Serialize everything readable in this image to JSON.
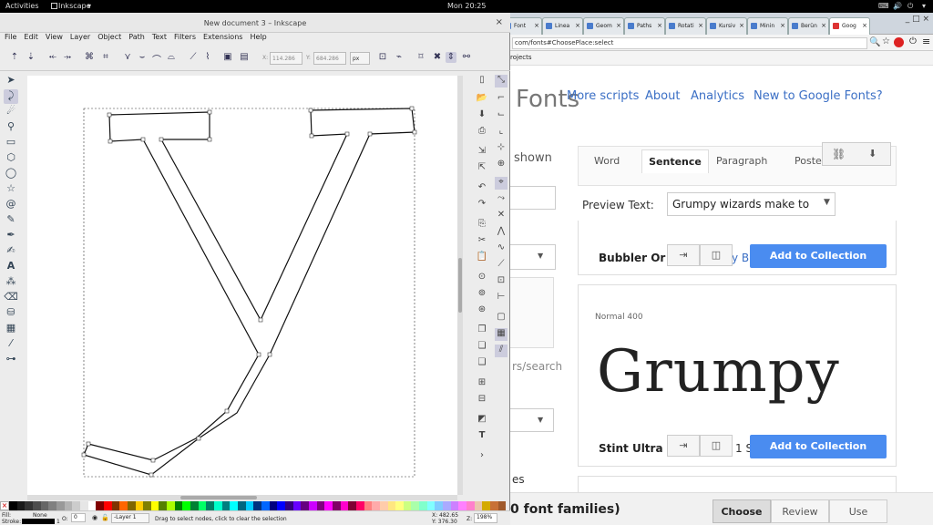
{
  "topbar": {
    "activities": "Activities",
    "app": "Inkscape",
    "clock": "Mon 20:25"
  },
  "inkscape": {
    "title": "New document 3 – Inkscape",
    "menu": [
      "File",
      "Edit",
      "View",
      "Layer",
      "Object",
      "Path",
      "Text",
      "Filters",
      "Extensions",
      "Help"
    ],
    "x_label": "X:",
    "x_value": "114.286",
    "y_label": "Y:",
    "y_value": "684.286",
    "unit": "px",
    "status_message": "Drag to select nodes, click to clear the selection",
    "fill_label": "Fill:",
    "fill_value": "None",
    "stroke_label": "Stroke:",
    "stroke_width": "1",
    "opacity_label": "O:",
    "opacity_value": "0",
    "layer": "-Layer 1",
    "cursor_x": "X: 482.65",
    "cursor_y": "Y: 376.30",
    "zoom_label": "Z:",
    "zoom": "198%",
    "palette": [
      "#000000",
      "#1a1a1a",
      "#333333",
      "#4d4d4d",
      "#666666",
      "#808080",
      "#999999",
      "#b3b3b3",
      "#cccccc",
      "#e6e6e6",
      "#ffffff",
      "#800000",
      "#ff0000",
      "#803300",
      "#ff6600",
      "#806600",
      "#ffcc00",
      "#808000",
      "#ffff00",
      "#558000",
      "#aaff00",
      "#008000",
      "#00ff00",
      "#008033",
      "#00ff66",
      "#008066",
      "#00ffcc",
      "#008080",
      "#00ffff",
      "#006680",
      "#00ccff",
      "#003380",
      "#0066ff",
      "#000080",
      "#0000ff",
      "#330080",
      "#6600ff",
      "#660080",
      "#cc00ff",
      "#800080",
      "#ff00ff",
      "#800066",
      "#ff00cc",
      "#800033",
      "#ff0066",
      "#ff8080",
      "#ffaaaa",
      "#ffccaa",
      "#ffe680",
      "#ffff80",
      "#ccff80",
      "#aaffaa",
      "#80ffcc",
      "#80ffff",
      "#80ccff",
      "#aaaaff",
      "#cc80ff",
      "#ff80ff",
      "#ff80cc",
      "#e9c6af",
      "#d4aa00",
      "#c87137",
      "#a05a2c"
    ]
  },
  "chrome": {
    "tabs": [
      "Font",
      "Linea",
      "Geom",
      "Paths",
      "Rotati",
      "Kursiv",
      "Minin",
      "Berün",
      "Goog"
    ],
    "url": "com/fonts#ChoosePlace:select",
    "bookmark": "rojects",
    "nav": [
      "More scripts",
      "About",
      "Analytics",
      "New to Google Fonts?"
    ],
    "logo": "Fonts",
    "shown": "shown",
    "preview_tabs": [
      "Word",
      "Sentence",
      "Paragraph",
      "Poste"
    ],
    "preview_label": "Preview Text:",
    "preview_value": "Grumpy wizards make to",
    "search_fragment": "rs/search",
    "font1": "Bubbler Or",
    "font1_tail": "y B",
    "add_label": "Add to Collection",
    "style_label": "Normal 400",
    "sample": "Grumpy",
    "font2": "Stint Ultra",
    "font2_tail": "1 S",
    "bottom_count": "0 font families)",
    "bottom_es": "es",
    "choose": "Choose",
    "review": "Review",
    "use": "Use"
  }
}
